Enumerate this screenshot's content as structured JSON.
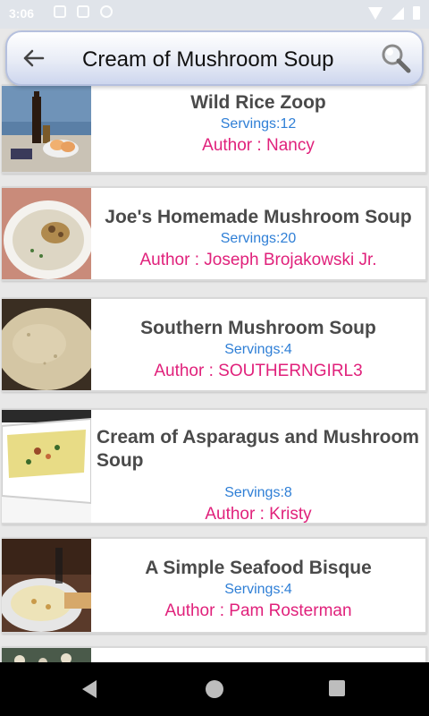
{
  "status_bar": {
    "time": "3:06"
  },
  "search": {
    "query": "Cream of Mushroom Soup"
  },
  "recipes": [
    {
      "title": "Wild Rice Zoop",
      "servings": "Servings:12",
      "author": "Author : Nancy",
      "image": "wine-and-melon-photo"
    },
    {
      "title": "Joe's Homemade Mushroom Soup",
      "servings": "Servings:20",
      "author": "Author : Joseph Brojakowski Jr.",
      "image": "mushroom-soup-bowl-photo"
    },
    {
      "title": "Southern Mushroom Soup",
      "servings": "Servings:4",
      "author": "Author : SOUTHERNGIRL3",
      "image": "creamy-soup-photo"
    },
    {
      "title": "Cream of Asparagus and Mushroom Soup",
      "servings": "Servings:8",
      "author": "Author : Kristy",
      "image": "asparagus-soup-dish-photo"
    },
    {
      "title": "A Simple Seafood Bisque",
      "servings": "Servings:4",
      "author": "Author : Pam Rosterman",
      "image": "seafood-bisque-photo"
    }
  ],
  "colors": {
    "servings": "#2f7fd6",
    "author": "#e0217b",
    "title": "#4a4a4a"
  },
  "icons": {
    "back": "arrow-left-icon",
    "search": "magnifier-icon"
  }
}
